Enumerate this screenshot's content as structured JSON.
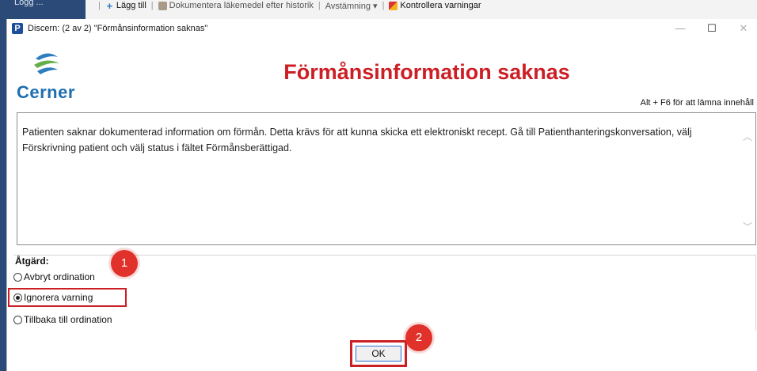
{
  "background": {
    "left_panel_text": "Logg ...",
    "toolbar": [
      {
        "label": "Lägg till",
        "icon": "plus-icon"
      },
      {
        "label": "Dokumentera läkemedel efter historik",
        "icon": "document-icon"
      },
      {
        "label": "Avstämning ▾",
        "icon": ""
      },
      {
        "label": "Kontrollera varningar",
        "icon": "check-warnings-icon"
      }
    ]
  },
  "dialog": {
    "title": "Discern: (2 av 2) \"Förmånsinformation saknas\"",
    "window_buttons": {
      "minimize": "—",
      "maximize": "☐",
      "close": "✕"
    },
    "logo_text": "Cerner",
    "heading": "Förmånsinformation saknas",
    "hint": "Alt + F6 för att lämna innehåll",
    "message": "Patienten saknar dokumenterad information om förmån. Detta krävs för att kunna skicka ett elektroniskt recept. Gå till Patienthanteringskonversation, välj Förskrivning patient och välj status i fältet Förmånsberättigad.",
    "action_label": "Åtgärd:",
    "options": [
      {
        "label": "Avbryt ordination",
        "selected": false
      },
      {
        "label": "Ignorera varning",
        "selected": true
      },
      {
        "label": "Tillbaka till ordination",
        "selected": false
      }
    ],
    "ok_label": "OK"
  },
  "callouts": {
    "step1": "1",
    "step2": "2"
  },
  "colors": {
    "accent_red": "#cc1f25",
    "brand_blue": "#1e6fb0",
    "callout": "#e0312a"
  }
}
